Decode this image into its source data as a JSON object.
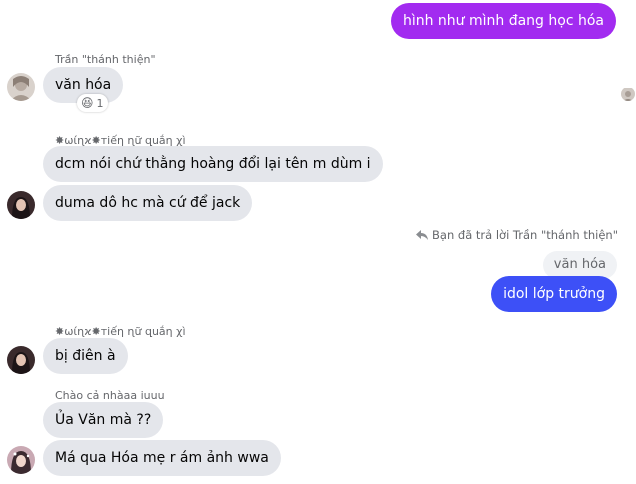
{
  "colors": {
    "gradient_purple": "#a22bf0",
    "gradient_blue": "#3d50f7",
    "incoming_bubble": "#e4e6eb",
    "quoted_bubble": "#f0f2f5",
    "meta_text": "#65676b"
  },
  "messages": [
    {
      "text": "hình như mình đang học hóa"
    },
    {
      "sender": "Trần \"thánh thiện\"",
      "text": "văn hóa",
      "reaction": {
        "emoji": "😆",
        "count": "1"
      }
    },
    {
      "sender": "✸ωίɳϰ✸тiếη ɳữ զսắη χì",
      "text": "dcm nói chứ thằng hoàng đổi lại tên m dùm i"
    },
    {
      "text": "duma dô hc mà cứ để jack"
    },
    {
      "reply_context": "Bạn đã trả lời Trần \"thánh thiện\"",
      "quoted": "văn hóa",
      "text": "idol lớp trưởng"
    },
    {
      "sender": "✸ωίɳϰ✸тiếη ɳữ զսắη χì",
      "text": "bị điên à"
    },
    {
      "sender": "Chào cả nhàaa iuuu",
      "text": "Ủa Văn mà ??"
    },
    {
      "text": "Má qua Hóa mẹ r ám ảnh wwa"
    }
  ]
}
